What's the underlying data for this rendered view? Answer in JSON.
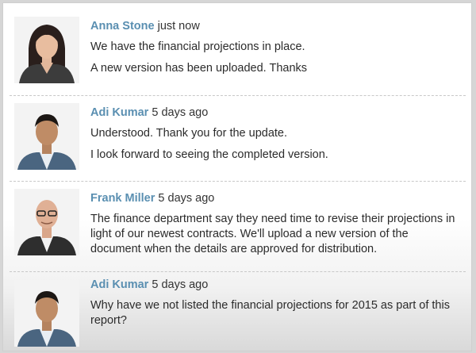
{
  "comments": [
    {
      "author": "Anna Stone",
      "time": "just now",
      "lines": [
        "We have the financial projections in place.",
        "A new version has been uploaded. Thanks"
      ]
    },
    {
      "author": "Adi Kumar",
      "time": "5 days ago",
      "lines": [
        "Understood. Thank you for the update.",
        "I look forward to seeing the completed version."
      ]
    },
    {
      "author": "Frank Miller",
      "time": "5 days ago",
      "lines": [
        "The finance department say they need time to revise their projections in light of our newest contracts. We'll upload a new version of the document when the details are approved for distribution."
      ]
    },
    {
      "author": "Adi Kumar",
      "time": "5 days ago",
      "lines": [
        "Why have we not listed the financial projections for 2015 as part of this report?"
      ]
    }
  ]
}
